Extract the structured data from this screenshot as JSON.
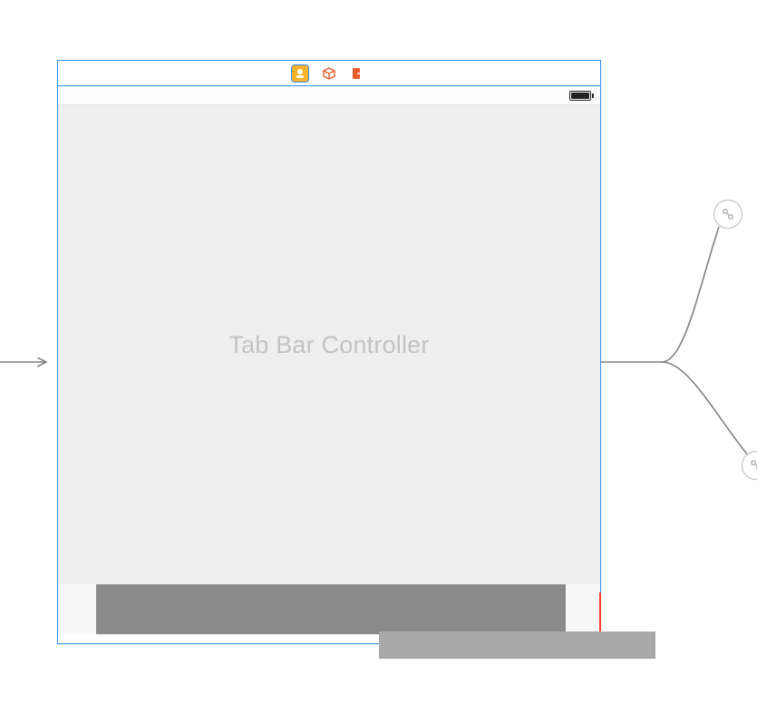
{
  "scene": {
    "placeholder_title": "Tab Bar Controller",
    "dock": {
      "icons": [
        "view-controller-icon",
        "first-responder-icon",
        "exit-icon"
      ]
    },
    "statusbar": {
      "battery_level": 100
    }
  }
}
